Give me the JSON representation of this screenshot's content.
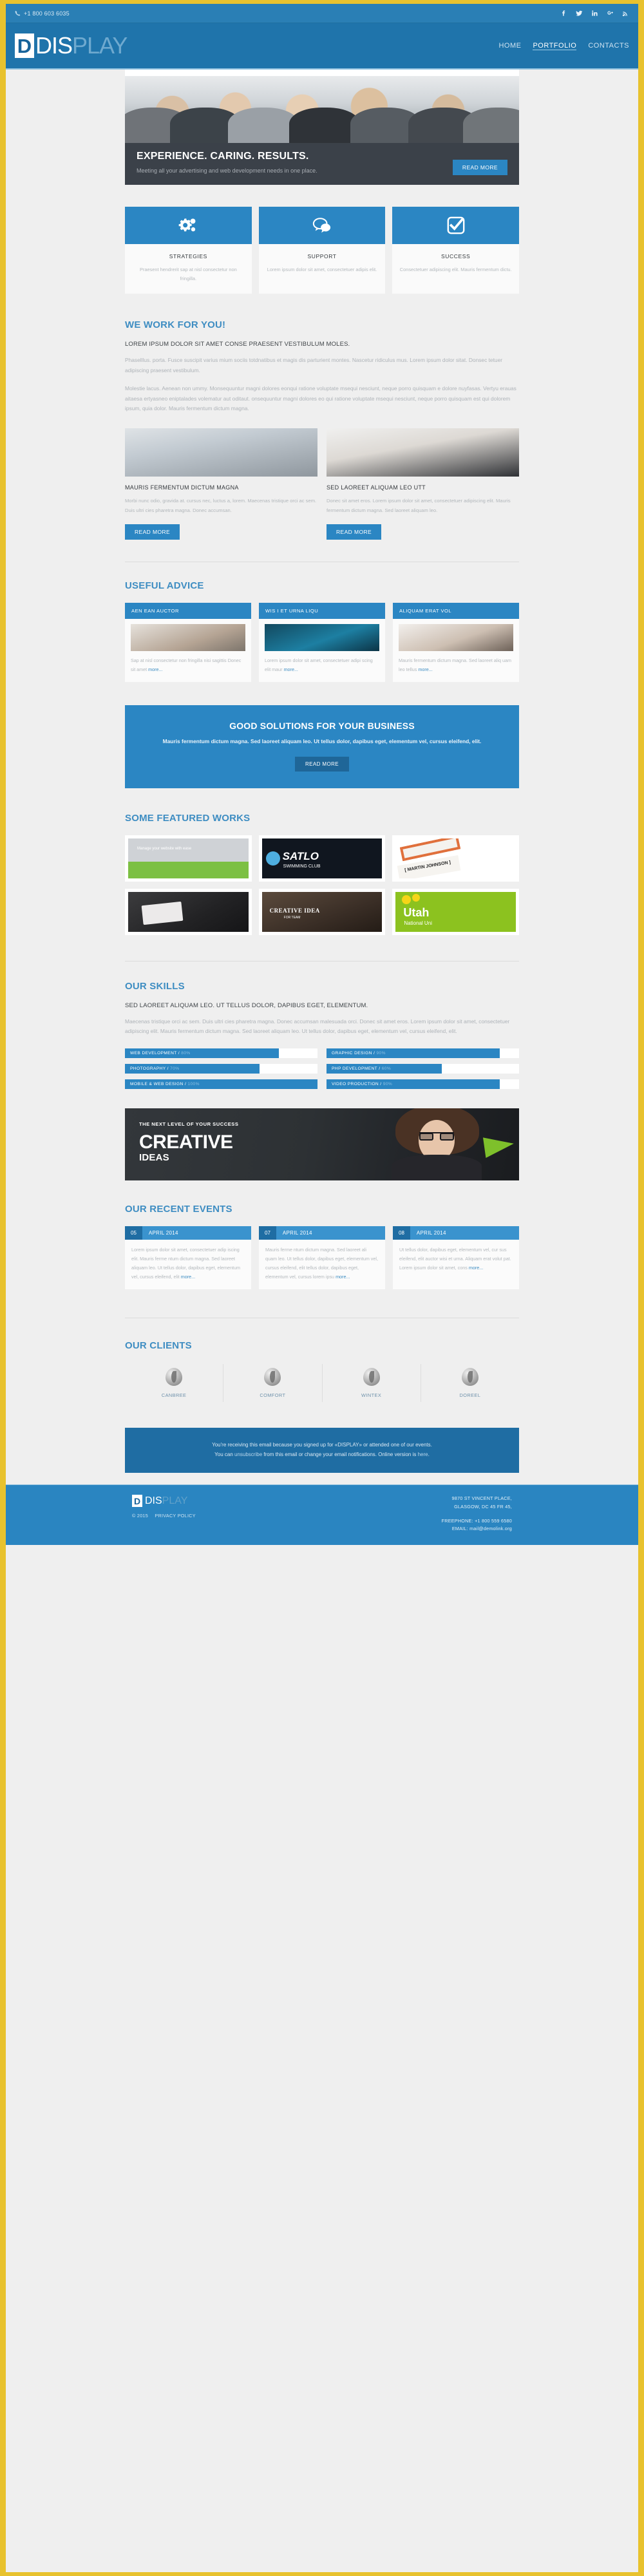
{
  "topbar": {
    "phone": "+1 800 603 6035",
    "socials": [
      {
        "name": "facebook-icon",
        "glyph": "f"
      },
      {
        "name": "twitter-icon",
        "glyph": "t"
      },
      {
        "name": "linkedin-icon",
        "glyph": "in"
      },
      {
        "name": "googleplus-icon",
        "glyph": "g+"
      },
      {
        "name": "rss-icon",
        "glyph": "rss"
      }
    ]
  },
  "header": {
    "logo_box": "D",
    "logo_part1": "DIS",
    "logo_part2": "PLAY",
    "nav": [
      {
        "label": "HOME",
        "active": false
      },
      {
        "label": "PORTFOLIO",
        "active": true
      },
      {
        "label": "CONTACTS",
        "active": false
      }
    ]
  },
  "hero": {
    "title": "EXPERIENCE. CARING. RESULTS.",
    "text": "Meeting all your advertising and web development needs in one place.",
    "button": "READ MORE"
  },
  "features": [
    {
      "icon": "gears-icon",
      "title": "STRATEGIES",
      "text": "Praesent hendrerit sap at nisl consectetur non fringilla."
    },
    {
      "icon": "chat-bubbles-icon",
      "title": "SUPPORT",
      "text": "Lorem ipsum dolor sit amet, consectetuer adipis elit."
    },
    {
      "icon": "checkbox-icon",
      "title": "SUCCESS",
      "text": "Consectetuer adipiscing elit. Mauris fermentum dictu."
    }
  ],
  "work_for_you": {
    "title": "WE WORK FOR YOU!",
    "subtitle": "LOREM IPSUM DOLOR SIT AMET CONSE PRAESENT VESTIBULUM MOLES.",
    "para1": "Phaselllus. porta. Fusce suscipit varius mium sociis totdnatibus et magis dis parturient montes. Nascetur ridiculus mus. Lorem ipsum dolor sitat. Donsec tetuer adipiscing praesent vestibulum.",
    "para2": "Molestie lacus. Aenean non ummy. Monsequuntur magni dolores eonqui ratione voluptate msequi nesciunt, neque porro quisquam e dolore nuyfasas. Vertyu erauas aitaesa ertyasneo eniptalades volematur aut oditaut. onsequuntur magni dolores eo qui ratione voluptate msequi nesciunt, neque porro quisquam est qui dolorem ipsum, quia dolor. Mauris fermentum dictum magna."
  },
  "columns": [
    {
      "title": "MAURIS FERMENTUM DICTUM MAGNA",
      "text": "Morbi nunc odio, gravida at. cursus nec, luctus a, lorem. Maecenas tristique orci ac sem. Duis ultri cies pharetra magna. Donec accumsan.",
      "button": "READ MORE"
    },
    {
      "title": "SED LAOREET ALIQUAM LEO UTT",
      "text": "Donec sit amet eros. Lorem ipsum dolor sit amet, consectetuer adipiscing elit. Mauris fermentum dictum magna. Sed laoreet aliquam leo.",
      "button": "READ MORE"
    }
  ],
  "advice": {
    "title": "USEFUL ADVICE",
    "cards": [
      {
        "head": "AEN EAN AUCTOR",
        "text": "Sap at nisl consectetur non fringilla nisi sagittis Donec sit amet",
        "more": "more..."
      },
      {
        "head": "WIS I ET URNA LIQU",
        "text": "Lorem ipsum dolor sit amet, consectetuer adipi scing elit maur",
        "more": "more..."
      },
      {
        "head": "ALIQUAM ERAT VOL",
        "text": "Mauris fermentum dictum magna. Sed laoreet aliq uam leo tellus",
        "more": "more..."
      }
    ]
  },
  "cta": {
    "title": "GOOD SOLUTIONS FOR YOUR BUSINESS",
    "text": "Mauris fermentum dictum magna. Sed laoreet aliquam leo. Ut tellus dolor, dapibus eget, elementum vel, cursus eleifend, elit.",
    "button": "READ MORE"
  },
  "works": {
    "title": "SOME FEATURED WORKS",
    "items": [
      {
        "name": "work-cms-laptop",
        "caption": "Manage your website with ease"
      },
      {
        "name": "work-satlo-swimming-club",
        "caption": "SATLO",
        "sub": "SWIMMING CLUB"
      },
      {
        "name": "work-martin-johnson-cards",
        "caption": "[ MARTIN JOHNSON ]"
      },
      {
        "name": "work-dark-business-card",
        "caption": ""
      },
      {
        "name": "work-creative-ideas-book",
        "caption": "CREATIVE IDEA",
        "sub": "FOR TEAM"
      },
      {
        "name": "work-utah-national-university",
        "caption": "Utah",
        "sub": "National Uni"
      }
    ]
  },
  "skills": {
    "title": "OUR SKILLS",
    "subtitle": "SED LAOREET ALIQUAM LEO. UT TELLUS DOLOR, DAPIBUS EGET, ELEMENTUM.",
    "text": "Maecenas tristique orci ac sem. Duis ultri cies pharetra magna. Donec accumsan malesuada orci. Donec sit amet eros. Lorem ipsum dolor sit amet, consectetuer adipiscing elit. Mauris fermentum dictum magna. Sed laoreet aliquam leo. Ut tellus dolor, dapibus eget, elementum vel, cursus eleifend, elit.",
    "bars": [
      {
        "label": "WEB DEVELOPMENT /",
        "pct": "80%",
        "value": 80
      },
      {
        "label": "GRAPHIC DESIGN /",
        "pct": "90%",
        "value": 90
      },
      {
        "label": "PHOTOGRAPHY /",
        "pct": "70%",
        "value": 70
      },
      {
        "label": "PHP DEVELOPMENT /",
        "pct": "60%",
        "value": 60
      },
      {
        "label": "MOBILE & WEB DESIGN /",
        "pct": "100%",
        "value": 100
      },
      {
        "label": "VIDEO PRODUCTION /",
        "pct": "90%",
        "value": 90
      }
    ]
  },
  "creative": {
    "kicker": "THE NEXT LEVEL OF YOUR SUCCESS",
    "big": "CREATIVE",
    "small": "IDEAS"
  },
  "events": {
    "title": "OUR RECENT EVENTS",
    "items": [
      {
        "day": "05",
        "month": "APRIL 2014",
        "text": "Lorem ipsum dolor sit amet, consectetuer adip iscing elit. Mauris ferme ntum dictum magna. Sed laoreet aliquam leo. Ut tellus dolor, dapibus eget, elementum vel, cursus eleifend, elit",
        "more": "more..."
      },
      {
        "day": "07",
        "month": "APRIL 2014",
        "text": "Mauris ferme ntum dictum magna. Sed laoreet ali quam leo. Ut tellus dolor, dapibus eget, elementum vel, cursus eleifend, elit tellus dolor, dapibus eget, elementum vel, cursus lorem ipsu",
        "more": "more..."
      },
      {
        "day": "08",
        "month": "APRIL 2014",
        "text": "Ut tellus dolor, dapibus eget, elementum vel, cur sus eleifend, elit auctor wisi et urna. Aliquam erat volut pat. Lorem ipsum dolor sit amet, cons",
        "more": "more..."
      }
    ]
  },
  "clients": {
    "title": "OUR CLIENTS",
    "items": [
      {
        "name": "CANBREE"
      },
      {
        "name": "COMFORT"
      },
      {
        "name": "WINTEX"
      },
      {
        "name": "DOREEL"
      }
    ]
  },
  "notice": {
    "line1_a": "You're receiving this email because you signed up for «DISPLAY» or attended one of our events.",
    "line2_a": "You can ",
    "unsubscribe": "unsubscribe",
    "line2_b": " from this email or change your email notifications. Online version is ",
    "here": "here",
    "line2_c": "."
  },
  "footer": {
    "logo_box": "D",
    "logo_part1": "DIS",
    "logo_part2": "PLAY",
    "copyright": "© 2015",
    "privacy": "PRIVACY POLICY",
    "address_line1": "9870 ST VINCENT PLACE,",
    "address_line2": "GLASGOW, DC 45 FR 45,",
    "freephone": "FREEPHONE: +1 800 559 6580",
    "email": "EMAIL: mail@demolink.org"
  },
  "colors": {
    "accent": "#2b86c3",
    "header": "#1f74ab",
    "border": "#e8c22e",
    "dark": "#3b4149"
  }
}
